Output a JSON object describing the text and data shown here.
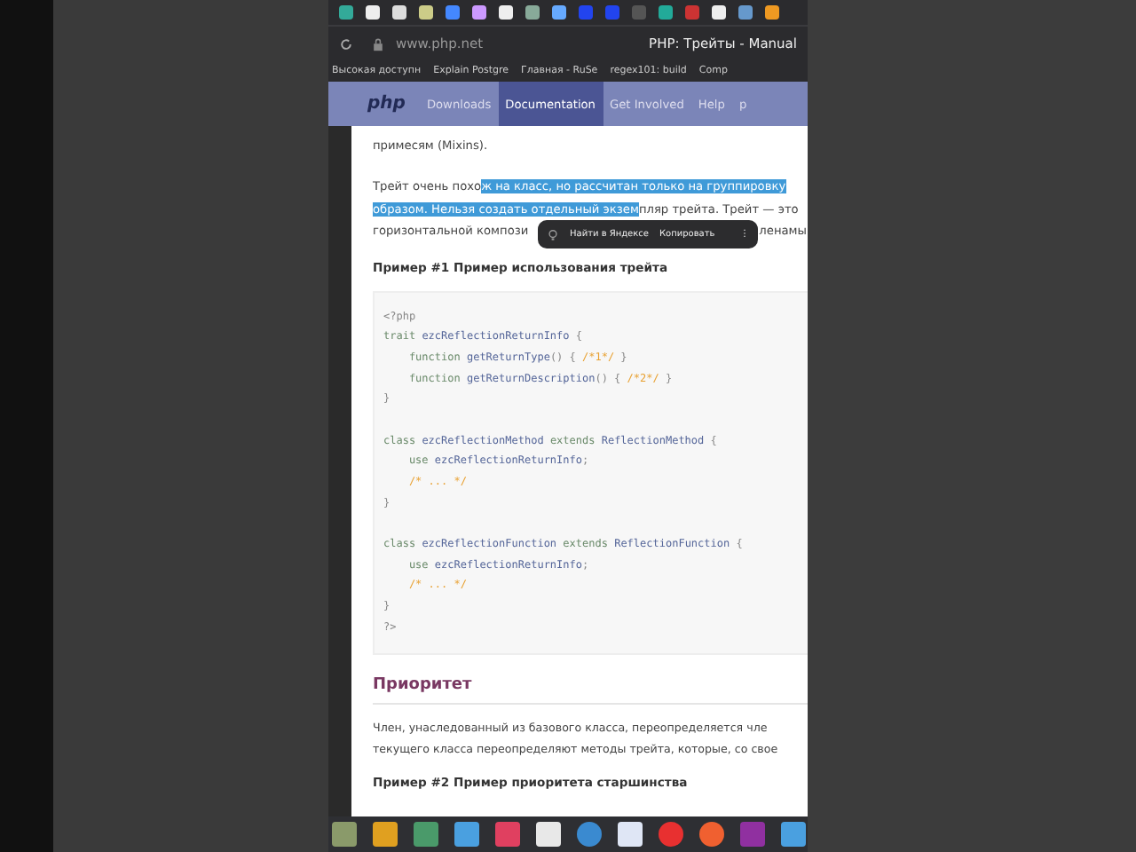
{
  "browser": {
    "url": "www.php.net",
    "title": "PHP: Трейты - Manual",
    "bookmarks": [
      "Высокая доступн",
      "Explain Postgre",
      "Главная - RuSe",
      "regex101: build",
      "Comp"
    ]
  },
  "nav": {
    "logo": "php",
    "items": [
      {
        "label": "Downloads",
        "selected": false
      },
      {
        "label": "Documentation",
        "selected": true
      },
      {
        "label": "Get Involved",
        "selected": false
      },
      {
        "label": "Help",
        "selected": false
      },
      {
        "label": "p",
        "selected": false
      }
    ]
  },
  "intro_tail": "примесям (Mixins).",
  "paragraph_lines": [
    [
      {
        "text": "Трейт очень похо",
        "selected": false
      },
      {
        "text": "ж на класс, но рассчитан только на группировку",
        "selected": true
      }
    ],
    [
      {
        "text": "образом. Нельзя создать отдельный экзем",
        "selected": true
      },
      {
        "text": "пляр трейта. Трейт — это",
        "selected": false
      }
    ],
    [
      {
        "text": "горизонтальной компози",
        "selected": false
      },
      {
        "text": "ленамы",
        "selected": false
      }
    ]
  ],
  "context_menu": {
    "items": [
      "Найти в Яндексе",
      "Копировать"
    ],
    "more": "⋮"
  },
  "example1": {
    "title": "Пример #1 Пример использования трейта",
    "code_blocks": [
      [
        [
          {
            "t": "<?php",
            "kind": "plain"
          }
        ],
        [
          {
            "t": "trait ",
            "kind": "kw"
          },
          {
            "t": "ezcReflectionReturnInfo ",
            "kind": "name"
          },
          {
            "t": "{",
            "kind": "plain"
          }
        ],
        [
          {
            "t": "    function ",
            "kind": "kw"
          },
          {
            "t": "getReturnType",
            "kind": "name"
          },
          {
            "t": "() { ",
            "kind": "plain"
          },
          {
            "t": "/*1*/",
            "kind": "comment"
          },
          {
            "t": " }",
            "kind": "plain"
          }
        ],
        [
          {
            "t": "    function ",
            "kind": "kw"
          },
          {
            "t": "getReturnDescription",
            "kind": "name"
          },
          {
            "t": "() { ",
            "kind": "plain"
          },
          {
            "t": "/*2*/",
            "kind": "comment"
          },
          {
            "t": " }",
            "kind": "plain"
          }
        ],
        [
          {
            "t": "}",
            "kind": "plain"
          }
        ]
      ],
      [
        [
          {
            "t": "class ",
            "kind": "kw"
          },
          {
            "t": "ezcReflectionMethod ",
            "kind": "name"
          },
          {
            "t": "extends ",
            "kind": "kw"
          },
          {
            "t": "ReflectionMethod ",
            "kind": "name"
          },
          {
            "t": "{",
            "kind": "plain"
          }
        ],
        [
          {
            "t": "    use ",
            "kind": "kw"
          },
          {
            "t": "ezcReflectionReturnInfo",
            "kind": "name"
          },
          {
            "t": ";",
            "kind": "plain"
          }
        ],
        [
          {
            "t": "    /* ... */",
            "kind": "comment"
          }
        ],
        [
          {
            "t": "}",
            "kind": "plain"
          }
        ]
      ],
      [
        [
          {
            "t": "class ",
            "kind": "kw"
          },
          {
            "t": "ezcReflectionFunction ",
            "kind": "name"
          },
          {
            "t": "extends ",
            "kind": "kw"
          },
          {
            "t": "ReflectionFunction ",
            "kind": "name"
          },
          {
            "t": "{",
            "kind": "plain"
          }
        ],
        [
          {
            "t": "    use ",
            "kind": "kw"
          },
          {
            "t": "ezcReflectionReturnInfo",
            "kind": "name"
          },
          {
            "t": ";",
            "kind": "plain"
          }
        ],
        [
          {
            "t": "    /* ... */",
            "kind": "comment"
          }
        ],
        [
          {
            "t": "}",
            "kind": "plain"
          }
        ],
        [
          {
            "t": "?>",
            "kind": "plain"
          }
        ]
      ]
    ]
  },
  "section_title": "Приоритет",
  "section_lines": [
    "Член, унаследованный из базового класса, переопределяется чле",
    "текущего класса переопределяют методы трейта, которые, со свое"
  ],
  "example2_title": "Пример #2 Пример приоритета старшинства",
  "taskbar": [
    {
      "kind": "folder",
      "color": "#8a9a6a"
    },
    {
      "kind": "puzzle",
      "color": "#e0a020"
    },
    {
      "kind": "chart",
      "color": "#4a9a6a"
    },
    {
      "kind": "window",
      "color": "#4aa0e0"
    },
    {
      "kind": "cube",
      "color": "#e04060"
    },
    {
      "kind": "square",
      "color": "#e8e8e8"
    },
    {
      "kind": "globe",
      "color": "#3a8ad0"
    },
    {
      "kind": "pen",
      "color": "#dfe6f5"
    },
    {
      "kind": "letter",
      "color": "#e83030"
    },
    {
      "kind": "circle",
      "color": "#f06030"
    },
    {
      "kind": "square",
      "color": "#9030a0"
    },
    {
      "kind": "window",
      "color": "#4aa0e0"
    }
  ]
}
